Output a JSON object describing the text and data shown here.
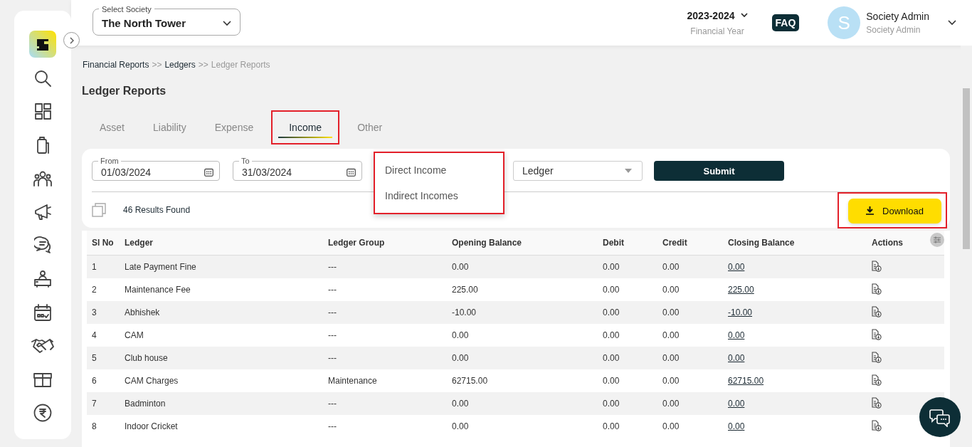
{
  "header": {
    "society_select": {
      "label": "Select Society",
      "value": "The North Tower"
    },
    "financial_year": {
      "value": "2023-2024",
      "caption": "Financial Year"
    },
    "faq": "FAQ",
    "user": {
      "initial": "S",
      "name": "Society Admin",
      "role": "Society Admin"
    }
  },
  "breadcrumb": [
    {
      "label": "Financial Reports",
      "current": false
    },
    {
      "label": "Ledgers",
      "current": false
    },
    {
      "label": "Ledger Reports",
      "current": true
    }
  ],
  "breadcrumb_separators": [
    ">>",
    ">>"
  ],
  "page_title": "Ledger Reports",
  "tabs": [
    {
      "label": "Asset",
      "selected": false,
      "highlighted": false
    },
    {
      "label": "Liability",
      "selected": false,
      "highlighted": false
    },
    {
      "label": "Expense",
      "selected": false,
      "highlighted": false
    },
    {
      "label": "Income",
      "selected": true,
      "highlighted": true
    },
    {
      "label": "Other",
      "selected": false,
      "highlighted": false
    }
  ],
  "filters": {
    "from": {
      "label": "From",
      "value": "01/03/2024"
    },
    "to": {
      "label": "To",
      "value": "31/03/2024"
    },
    "group_menu": {
      "highlighted": true,
      "options": [
        "Direct Income",
        "Indirect Incomes"
      ]
    },
    "ledger_select": {
      "value": "Ledger"
    },
    "submit": "Submit"
  },
  "results": "46 Results Found",
  "download": {
    "label": "Download",
    "highlighted": true
  },
  "table": {
    "columns": [
      "Sl No",
      "Ledger",
      "Ledger Group",
      "Opening Balance",
      "Debit",
      "Credit",
      "Closing Balance",
      "Actions"
    ],
    "rows": [
      {
        "sl": "1",
        "ledger": "Late Payment Fine",
        "group": "---",
        "opening": "0.00",
        "debit": "0.00",
        "credit": "0.00",
        "closing": "0.00"
      },
      {
        "sl": "2",
        "ledger": "Maintenance Fee",
        "group": "---",
        "opening": "225.00",
        "debit": "0.00",
        "credit": "0.00",
        "closing": "225.00"
      },
      {
        "sl": "3",
        "ledger": "Abhishek",
        "group": "---",
        "opening": "-10.00",
        "debit": "0.00",
        "credit": "0.00",
        "closing": "-10.00"
      },
      {
        "sl": "4",
        "ledger": "CAM",
        "group": "---",
        "opening": "0.00",
        "debit": "0.00",
        "credit": "0.00",
        "closing": "0.00"
      },
      {
        "sl": "5",
        "ledger": "Club house",
        "group": "---",
        "opening": "0.00",
        "debit": "0.00",
        "credit": "0.00",
        "closing": "0.00"
      },
      {
        "sl": "6",
        "ledger": "CAM Charges",
        "group": "Maintenance",
        "opening": "62715.00",
        "debit": "0.00",
        "credit": "0.00",
        "closing": "62715.00"
      },
      {
        "sl": "7",
        "ledger": "Badminton",
        "group": "---",
        "opening": "0.00",
        "debit": "0.00",
        "credit": "0.00",
        "closing": "0.00"
      },
      {
        "sl": "8",
        "ledger": "Indoor Cricket",
        "group": "---",
        "opening": "0.00",
        "debit": "0.00",
        "credit": "0.00",
        "closing": "0.00"
      }
    ]
  }
}
